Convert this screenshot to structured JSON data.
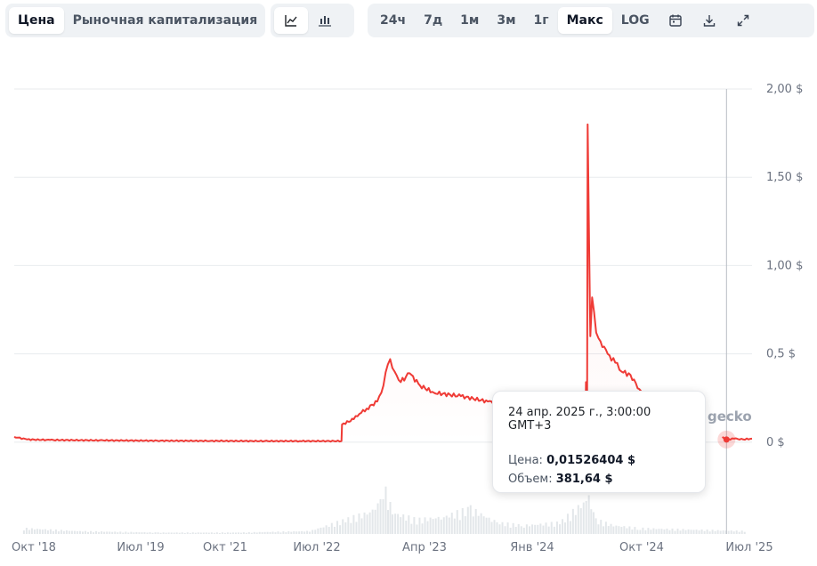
{
  "toolbar": {
    "view_tabs": [
      {
        "label": "Цена",
        "active": true
      },
      {
        "label": "Рыночная капитализация",
        "active": false
      }
    ],
    "chart_types": [
      {
        "icon": "line-chart-icon",
        "active": true
      },
      {
        "icon": "candlestick-chart-icon",
        "active": false
      }
    ],
    "ranges": [
      {
        "label": "24ч",
        "active": false
      },
      {
        "label": "7д",
        "active": false
      },
      {
        "label": "1м",
        "active": false
      },
      {
        "label": "3м",
        "active": false
      },
      {
        "label": "1г",
        "active": false
      },
      {
        "label": "Макс",
        "active": true
      },
      {
        "label": "LOG",
        "active": false
      }
    ],
    "actions": [
      {
        "icon": "calendar-icon"
      },
      {
        "icon": "download-icon"
      },
      {
        "icon": "expand-icon"
      }
    ]
  },
  "tooltip": {
    "date": "24 апр. 2025 г., 3:00:00 GMT+3",
    "price_label": "Цена:",
    "price_value": "0,01526404 $",
    "volume_label": "Объем:",
    "volume_value": "381,64 $"
  },
  "watermark": "gecko",
  "colors": {
    "line": "#ef3b36",
    "grid": "#e8ebee",
    "axis_text": "#6b7280",
    "volume": "#e3e7ea"
  },
  "chart_data": {
    "type": "line",
    "x_ticks": [
      "Окт '18",
      "Июл '19",
      "Окт '21",
      "Июл '22",
      "Апр '23",
      "Янв '24",
      "Окт '24",
      "Июл '25"
    ],
    "y_ticks": [
      "2,00 $",
      "1,50 $",
      "1,00 $",
      "0,5 $",
      "0 $"
    ],
    "ylim": [
      -0.52,
      2.0
    ],
    "grid": true,
    "xlim": [
      "2018-09-01",
      "2025-07-20"
    ],
    "hover_date": "2025-04-24",
    "series": [
      {
        "points": [
          [
            "2018-09-01",
            0.03
          ],
          [
            "2018-10-15",
            0.015
          ],
          [
            "2019-01-01",
            0.012
          ],
          [
            "2019-07-01",
            0.01
          ],
          [
            "2020-01-01",
            0.008
          ],
          [
            "2020-07-01",
            0.007
          ],
          [
            "2021-01-01",
            0.006
          ],
          [
            "2021-05-01",
            0.006
          ],
          [
            "2021-09-20",
            0.006
          ],
          [
            "2021-09-22",
            0.1
          ],
          [
            "2021-11-01",
            0.13
          ],
          [
            "2021-11-20",
            0.16
          ],
          [
            "2021-12-15",
            0.19
          ],
          [
            "2022-01-20",
            0.23
          ],
          [
            "2022-02-10",
            0.32
          ],
          [
            "2022-02-25",
            0.44
          ],
          [
            "2022-03-05",
            0.47
          ],
          [
            "2022-03-20",
            0.4
          ],
          [
            "2022-04-10",
            0.34
          ],
          [
            "2022-05-10",
            0.39
          ],
          [
            "2022-06-15",
            0.32
          ],
          [
            "2022-08-01",
            0.28
          ],
          [
            "2022-11-01",
            0.26
          ],
          [
            "2023-02-01",
            0.23
          ],
          [
            "2023-05-01",
            0.21
          ],
          [
            "2023-07-01",
            0.21
          ],
          [
            "2023-09-01",
            0.26
          ],
          [
            "2023-11-01",
            0.24
          ],
          [
            "2023-12-20",
            0.19
          ],
          [
            "2023-12-31",
            0.15
          ],
          [
            "2024-01-01",
            0.34
          ],
          [
            "2024-01-05",
            0.24
          ],
          [
            "2024-01-07",
            1.8
          ],
          [
            "2024-01-12",
            1.1
          ],
          [
            "2024-01-16",
            0.6
          ],
          [
            "2024-01-22",
            0.82
          ],
          [
            "2024-02-05",
            0.62
          ],
          [
            "2024-02-20",
            0.57
          ],
          [
            "2024-03-15",
            0.5
          ],
          [
            "2024-04-10",
            0.45
          ],
          [
            "2024-05-01",
            0.4
          ],
          [
            "2024-06-01",
            0.38
          ],
          [
            "2024-07-01",
            0.3
          ],
          [
            "2024-07-20",
            0.26
          ]
        ]
      },
      {
        "points": [
          [
            "2025-04-10",
            0.03
          ],
          [
            "2025-04-24",
            0.015
          ],
          [
            "2025-05-20",
            0.02
          ],
          [
            "2025-06-20",
            0.015
          ],
          [
            "2025-07-20",
            0.02
          ]
        ]
      }
    ],
    "volume_series": [
      [
        "2018-10-01",
        0.04
      ],
      [
        "2019-04-01",
        0.02
      ],
      [
        "2020-01-01",
        0.01
      ],
      [
        "2020-10-01",
        0.01
      ],
      [
        "2021-06-01",
        0.02
      ],
      [
        "2021-10-01",
        0.1
      ],
      [
        "2022-01-01",
        0.16
      ],
      [
        "2022-02-15",
        0.3
      ],
      [
        "2022-03-10",
        0.15
      ],
      [
        "2022-06-01",
        0.1
      ],
      [
        "2022-09-01",
        0.12
      ],
      [
        "2022-12-01",
        0.18
      ],
      [
        "2023-03-01",
        0.08
      ],
      [
        "2023-06-01",
        0.06
      ],
      [
        "2023-10-01",
        0.08
      ],
      [
        "2024-01-08",
        0.25
      ],
      [
        "2024-02-01",
        0.1
      ],
      [
        "2024-04-01",
        0.06
      ],
      [
        "2024-07-01",
        0.04
      ],
      [
        "2025-07-01",
        0.02
      ]
    ]
  }
}
